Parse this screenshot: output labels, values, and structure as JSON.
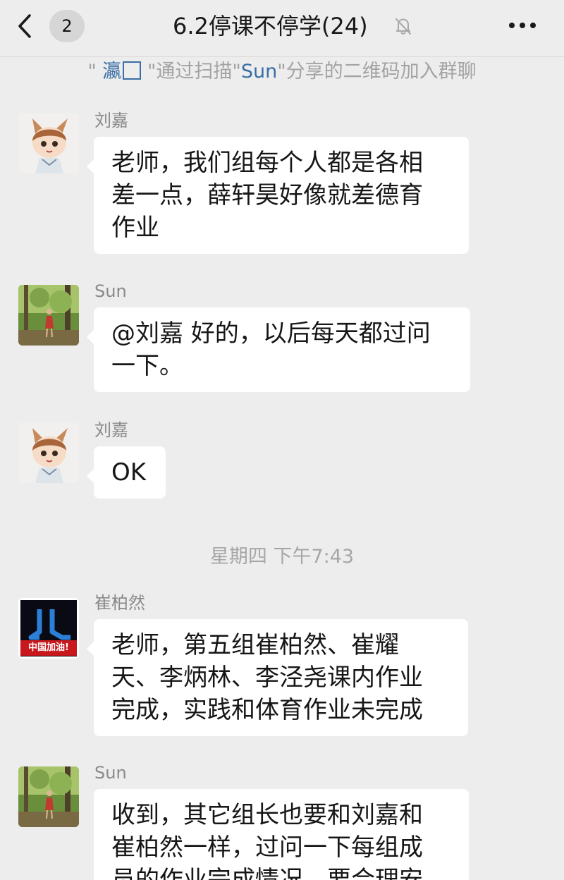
{
  "header": {
    "unread_count": "2",
    "title": "6.2停课不停学(24)",
    "icons": {
      "back": "chevron-left-icon",
      "mute": "bell-muted-icon",
      "more": "more-dots-icon"
    }
  },
  "system_notice": {
    "quote_open": "\"",
    "inviter": "瀛",
    "text_before": "\"通过扫描\"",
    "sharer": "Sun",
    "text_after": "\"分享的二维码加入群聊"
  },
  "messages": [
    {
      "sender": "刘嘉",
      "lines": [
        "老师，我们组每个人都是各相",
        "差一点，薛轩昊好像就差德育",
        "作业"
      ]
    },
    {
      "sender": "Sun",
      "lines": [
        "@刘嘉 好的，以后每天都过问",
        "一下。"
      ]
    },
    {
      "sender": "刘嘉",
      "lines": [
        "OK"
      ]
    },
    {
      "sender": "崔柏然",
      "avatar_text": "中国加油!",
      "lines": [
        "老师，第五组崔柏然、崔耀",
        "天、李炳林、李泾尧课内作业",
        "完成，实践和体育作业未完成"
      ]
    },
    {
      "sender": "Sun",
      "lines": [
        "收到，其它组长也要和刘嘉和",
        "崔柏然一样，过问一下每组成",
        "员的作业完成情况，要合理安"
      ]
    }
  ],
  "time_separator": "星期四 下午7:43",
  "colors": {
    "background": "#ededed",
    "bubble": "#ffffff",
    "link": "#3a6ea5",
    "meta_text": "#a3a3a3"
  }
}
